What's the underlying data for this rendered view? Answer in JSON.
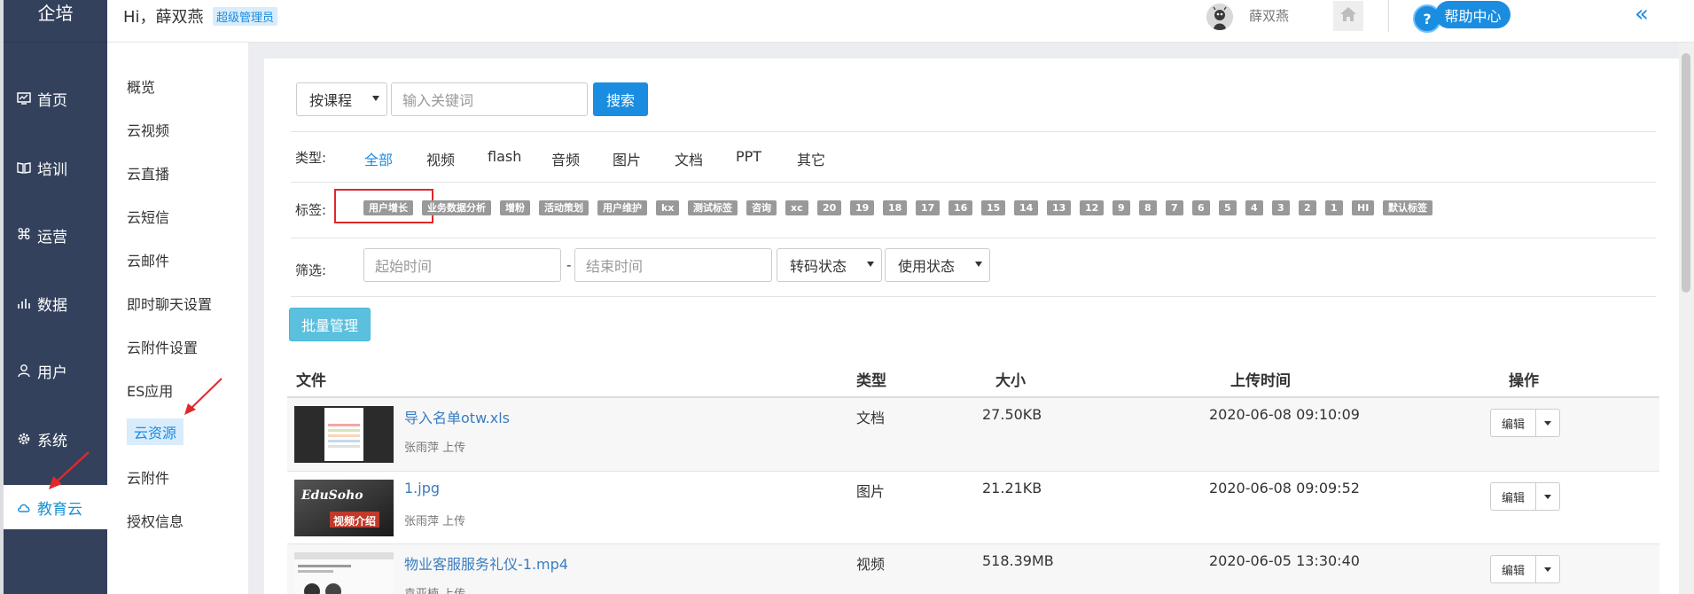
{
  "sidebar": {
    "brand": "企培",
    "items": [
      {
        "label": "首页",
        "icon": "dashboard-icon"
      },
      {
        "label": "培训",
        "icon": "book-icon"
      },
      {
        "label": "运营",
        "icon": "command-icon"
      },
      {
        "label": "数据",
        "icon": "chart-icon"
      },
      {
        "label": "用户",
        "icon": "user-icon"
      },
      {
        "label": "系统",
        "icon": "gear-icon"
      },
      {
        "label": "教育云",
        "icon": "cloud-icon",
        "active": true
      }
    ]
  },
  "header": {
    "greeting": "Hi，薛双燕",
    "role_badge": "超级管理员",
    "username": "薛双燕",
    "help_label": "帮助中心",
    "help_q": "?",
    "collapse_symbol": "«"
  },
  "subnav": {
    "items": [
      "概览",
      "云视频",
      "云直播",
      "云短信",
      "云邮件",
      "即时聊天设置",
      "云附件设置",
      "ES应用",
      "云资源",
      "云附件",
      "授权信息"
    ],
    "active_index": 8
  },
  "search": {
    "scope": "按课程",
    "keyword_placeholder": "输入关键词",
    "button": "搜索"
  },
  "filters": {
    "type_label": "类型:",
    "types": [
      "全部",
      "视频",
      "flash",
      "音频",
      "图片",
      "文档",
      "PPT",
      "其它"
    ],
    "active_type": 0,
    "tag_label": "标签:",
    "tags": [
      "用户增长",
      "业务数据分析",
      "增粉",
      "活动策划",
      "用户维护",
      "kx",
      "测试标签",
      "咨询",
      "xc",
      "20",
      "19",
      "18",
      "17",
      "16",
      "15",
      "14",
      "13",
      "12",
      "9",
      "8",
      "7",
      "6",
      "5",
      "4",
      "3",
      "2",
      "1",
      "HI",
      "默认标签"
    ],
    "screen_label": "筛选:",
    "start_placeholder": "起始时间",
    "end_placeholder": "结束时间",
    "range_sep": "-",
    "transcode_select": "转码状态",
    "usage_select": "使用状态"
  },
  "batch_button": "批量管理",
  "table": {
    "headers": [
      "文件",
      "类型",
      "大小",
      "上传时间",
      "操作"
    ],
    "rows": [
      {
        "name": "导入名单otw.xls",
        "uploader": "张雨萍 上传",
        "type": "文档",
        "size": "27.50KB",
        "time": "2020-06-08 09:10:09",
        "action": "编辑"
      },
      {
        "name": "1.jpg",
        "uploader": "张雨萍 上传",
        "type": "图片",
        "size": "21.21KB",
        "time": "2020-06-08 09:09:52",
        "action": "编辑",
        "thumb_title": "EduSoho",
        "thumb_sub": "视频介绍"
      },
      {
        "name": "物业客服服务礼仪-1.mp4",
        "uploader": "袁亚楠 上传",
        "type": "视频",
        "size": "518.39MB",
        "time": "2020-06-05 13:30:40",
        "action": "编辑"
      }
    ]
  },
  "colors": {
    "primary": "#1a8de0",
    "sidebar_bg": "#33415c",
    "tag_bg": "#999999",
    "highlight_red": "#e0282b",
    "batch_btn": "#5bc0de"
  }
}
